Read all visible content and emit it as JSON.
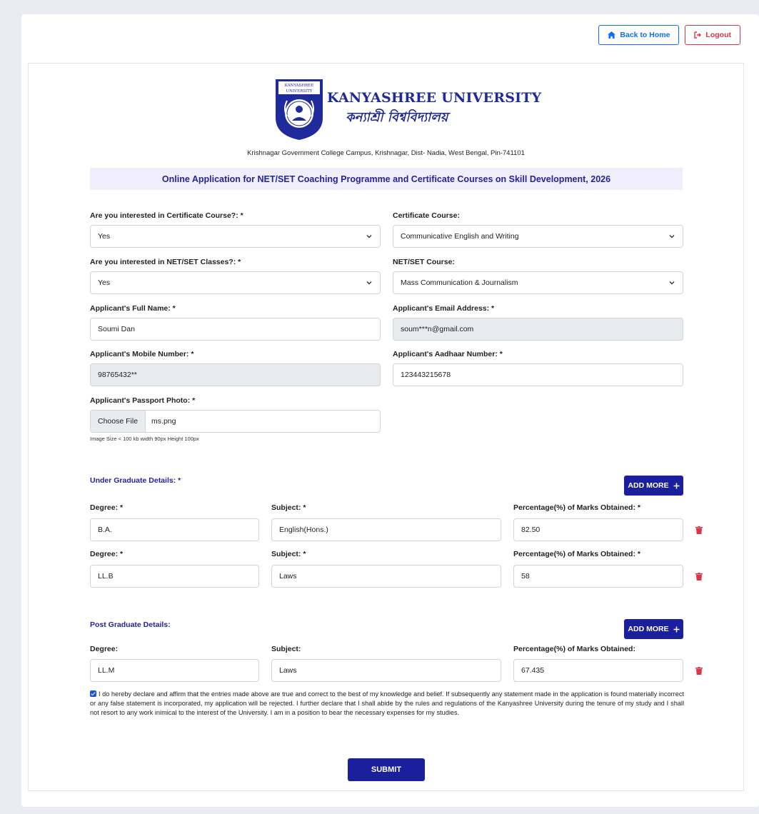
{
  "nav": {
    "home_label": "Back to Home",
    "logout_label": "Logout"
  },
  "header": {
    "university_en": "KANYASHREE UNIVERSITY",
    "university_bn": "কন্যাশ্রী বিশ্ববিদ্যালয়",
    "logo_text": "KANYASHREE UNIVERSITY",
    "address": "Krishnagar Government College Campus, Krishnagar, Dist- Nadia, West Bengal, Pin-741101",
    "banner": "Online Application for NET/SET Coaching Programme and Certificate Courses on Skill Development, 2026"
  },
  "form": {
    "cert_interest_label": "Are you interested in Certificate Course?: *",
    "cert_interest_value": "Yes",
    "cert_course_label": "Certificate Course:",
    "cert_course_value": "Communicative English and Writing",
    "net_interest_label": "Are you interested in NET/SET Classes?: *",
    "net_interest_value": "Yes",
    "net_course_label": "NET/SET Course:",
    "net_course_value": "Mass Communication & Journalism",
    "name_label": "Applicant's Full Name: *",
    "name_value": "Soumi Dan",
    "email_label": "Applicant's Email Address: *",
    "email_value": "soum***n@gmail.com",
    "mobile_label": "Applicant's Mobile Number: *",
    "mobile_value": "98765432**",
    "aadhaar_label": "Applicant's Aadhaar Number: *",
    "aadhaar_value": "123443215678",
    "photo_label": "Applicant's Passport Photo: *",
    "photo_button": "Choose File",
    "photo_file": "ms.png",
    "photo_hint": "Image Size < 100 kb width 90px Height 100px"
  },
  "ug": {
    "title": "Under Graduate Details: *",
    "add_label": "ADD MORE",
    "rows": [
      {
        "degree_label": "Degree: *",
        "subject_label": "Subject: *",
        "marks_label": "Percentage(%) of Marks Obtained: *",
        "degree": "B.A.",
        "subject": "English(Hons.)",
        "marks": "82.50"
      },
      {
        "degree_label": "Degree: *",
        "subject_label": "Subject: *",
        "marks_label": "Percentage(%) of Marks Obtained: *",
        "degree": "LL.B",
        "subject": "Laws",
        "marks": "58"
      }
    ]
  },
  "pg": {
    "title": "Post Graduate Details:",
    "add_label": "ADD MORE",
    "rows": [
      {
        "degree_label": "Degree:",
        "subject_label": "Subject:",
        "marks_label": "Percentage(%) of Marks Obtained:",
        "degree": "LL.M",
        "subject": "Laws",
        "marks": "67.435"
      }
    ]
  },
  "declaration": "I do hereby declare and affirm that the entries made above are true and correct to the best of my knowledge and belief. If subsequently any statement made in the application is found materially incorrect or any false statement is incorporated, my application will be rejected. I further declare that I shall abide by the rules and regulations of the Kanyashree University during the tenure of my study and I shall not resort to any work inimical to the interest of the University. I am in a position to bear the necessary expenses for my studies.",
  "submit_label": "SUBMIT",
  "colors": {
    "primary": "#1a1f9e",
    "danger": "#dc3545",
    "link": "#0d6efd"
  }
}
